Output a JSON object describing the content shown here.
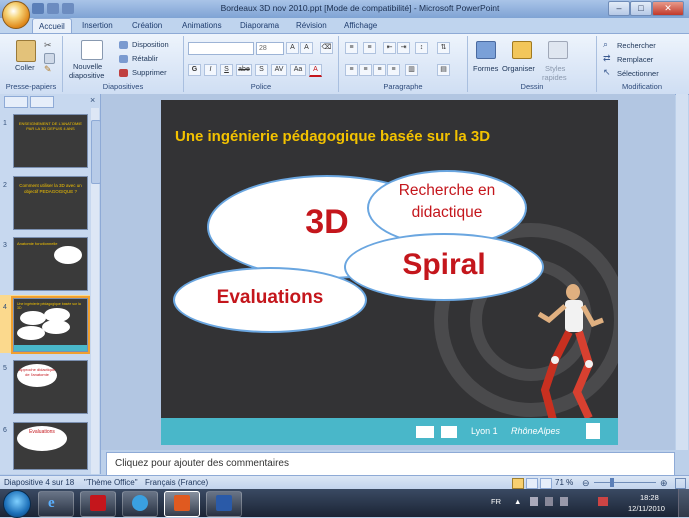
{
  "window": {
    "title": "Bordeaux 3D nov 2010.ppt [Mode de compatibilité] - Microsoft PowerPoint",
    "minimize": "–",
    "maximize": "□",
    "close": "✕"
  },
  "tabs": [
    "Accueil",
    "Insertion",
    "Création",
    "Animations",
    "Diaporama",
    "Révision",
    "Affichage"
  ],
  "ribbon": {
    "clipboard": {
      "paste": "Coller",
      "label": "Presse-papiers"
    },
    "slides": {
      "new_slide_1": "Nouvelle",
      "new_slide_2": "diapositive",
      "layout": "Disposition",
      "reset": "Rétablir",
      "delete": "Supprimer",
      "label": "Diapositives"
    },
    "font": {
      "size": "28",
      "label": "Police",
      "bold": "G",
      "italic": "I",
      "underline": "S",
      "strike": "abe",
      "shadow": "S",
      "spacing": "AV",
      "case": "Aa",
      "color": "A"
    },
    "paragraph": {
      "label": "Paragraphe"
    },
    "drawing": {
      "shapes": "Formes",
      "arrange": "Organiser",
      "styles_1": "Styles",
      "styles_2": "rapides",
      "label": "Dessin"
    },
    "editing": {
      "find": "Rechercher",
      "replace": "Remplacer",
      "select": "Sélectionner",
      "label": "Modification"
    }
  },
  "thumbnails": [
    {
      "num": "1",
      "title": "ENSEIGNEMENT DE L'ANATOMIE PAR LA 3D DEPUIS 4 ANS"
    },
    {
      "num": "2",
      "title": "Comment utiliser la 3D avec un objectif PEDAGOGIQUE ?"
    },
    {
      "num": "3",
      "title": "Anatomie fonctionnelle"
    },
    {
      "num": "4",
      "title": "Une ingénierie pédagogique basée sur la 3D"
    },
    {
      "num": "5",
      "title": "Approche didactique de l'anatomie"
    },
    {
      "num": "6",
      "title": "Evaluations"
    }
  ],
  "slide": {
    "title": "Une ingénierie pédagogique basée sur la 3D",
    "bubble_3d": "3D",
    "bubble_recherche_1": "Recherche en",
    "bubble_recherche_2": "didactique",
    "bubble_spiral": "Spiral",
    "bubble_evaluations": "Evaluations",
    "footer_lyon": "Lyon 1",
    "footer_rhone": "RhôneAlpes"
  },
  "notes_placeholder": "Cliquez pour ajouter des commentaires",
  "status": {
    "slide_counter": "Diapositive 4 sur 18",
    "theme": "\"Thème Office\"",
    "language": "Français (France)",
    "zoom": "71 %"
  },
  "taskbar": {
    "lang": "FR",
    "time": "18:28",
    "date": "12/11/2010"
  },
  "colors": {
    "slide_title": "#f3c200",
    "bubble_text": "#c4161c",
    "footer": "#49b7c9"
  }
}
